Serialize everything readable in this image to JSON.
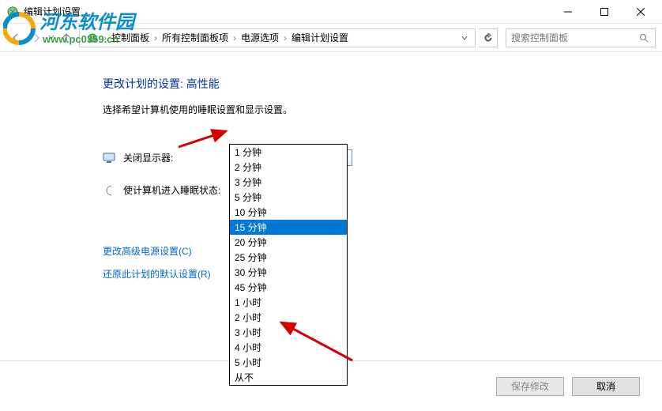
{
  "window": {
    "title": "编辑计划设置"
  },
  "breadcrumb": {
    "items": [
      "控制面板",
      "所有控制面板项",
      "电源选项",
      "编辑计划设置"
    ]
  },
  "search": {
    "placeholder": "搜索控制面板"
  },
  "page": {
    "heading_prefix": "更改计划的设置: ",
    "heading_plan": "高性能",
    "subheading": "选择希望计算机使用的睡眠设置和显示设置。"
  },
  "settings": {
    "display_off": {
      "label": "关闭显示器:",
      "value": "15 分钟"
    },
    "sleep": {
      "label": "使计算机进入睡眠状态:"
    }
  },
  "dropdown": {
    "options": [
      "1 分钟",
      "2 分钟",
      "3 分钟",
      "5 分钟",
      "10 分钟",
      "15 分钟",
      "20 分钟",
      "25 分钟",
      "30 分钟",
      "45 分钟",
      "1 小时",
      "2 小时",
      "3 小时",
      "4 小时",
      "5 小时",
      "从不"
    ],
    "selected": "15 分钟"
  },
  "links": {
    "advanced": "更改高级电源设置(C)",
    "restore": "还原此计划的默认设置(R)"
  },
  "footer": {
    "save": "保存修改",
    "cancel": "取消"
  },
  "watermark": {
    "line1": "河东软件园",
    "line2": "www.pc0359.cn"
  }
}
